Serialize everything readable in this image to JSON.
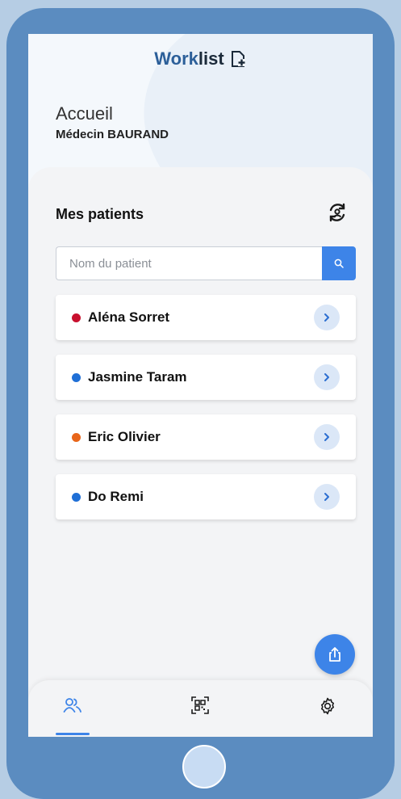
{
  "app": {
    "title_bold": "Work",
    "title_rest": "list"
  },
  "greeting": {
    "title": "Accueil",
    "doctor": "Médecin BAURAND"
  },
  "patients_panel": {
    "title": "Mes patients",
    "search_placeholder": "Nom du patient",
    "items": [
      {
        "name": "Aléna Sorret",
        "status_color": "#c8102e"
      },
      {
        "name": "Jasmine Taram",
        "status_color": "#1f6fd6"
      },
      {
        "name": "Eric Olivier",
        "status_color": "#e8651a"
      },
      {
        "name": "Do Remi",
        "status_color": "#1f6fd6"
      }
    ]
  },
  "icons": {
    "add_document": "add-document-icon",
    "refresh": "refresh-icon",
    "search": "search-icon",
    "chevron": "chevron-right-icon",
    "share": "share-icon",
    "patients_tab": "users-icon",
    "qr_tab": "qr-code-icon",
    "settings_tab": "gear-icon"
  },
  "colors": {
    "accent": "#3d84e8",
    "frame": "#5b8cc0"
  }
}
